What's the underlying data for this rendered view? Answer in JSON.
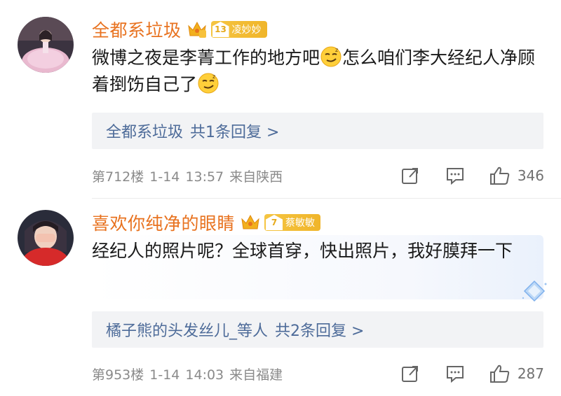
{
  "comments": [
    {
      "username": "全都系垃圾",
      "fan_level": "13",
      "fan_label": "凌妙妙",
      "text_parts": [
        "微博之夜是李菁工作的地方吧",
        "怎么咱们李大经纪人净顾着捯饬自己了"
      ],
      "replies": {
        "names": "全都系垃圾",
        "count_text": "共1条回复 >"
      },
      "floor": "第712楼",
      "date": "1-14",
      "time": "13:57",
      "location": "来自陕西",
      "likes": "346"
    },
    {
      "username": "喜欢你纯净的眼睛",
      "fan_level": "7",
      "fan_label": "蔡敏敏",
      "text": "经纪人的照片呢？全球首穿，快出照片，我好膜拜一下",
      "replies": {
        "names": "橘子熊的头发丝儿_等人",
        "count_text": "共2条回复 >"
      },
      "floor": "第953楼",
      "date": "1-14",
      "time": "14:03",
      "location": "来自福建",
      "likes": "287"
    }
  ],
  "colors": {
    "username": "#e8721f",
    "reply_link": "#4d6b99",
    "meta": "#8a8a8a",
    "badge": "#f0b52a"
  },
  "icons": [
    "crown-icon",
    "share-icon",
    "comment-icon",
    "like-icon",
    "smirk-emoji-icon",
    "diamond-badge-icon"
  ]
}
